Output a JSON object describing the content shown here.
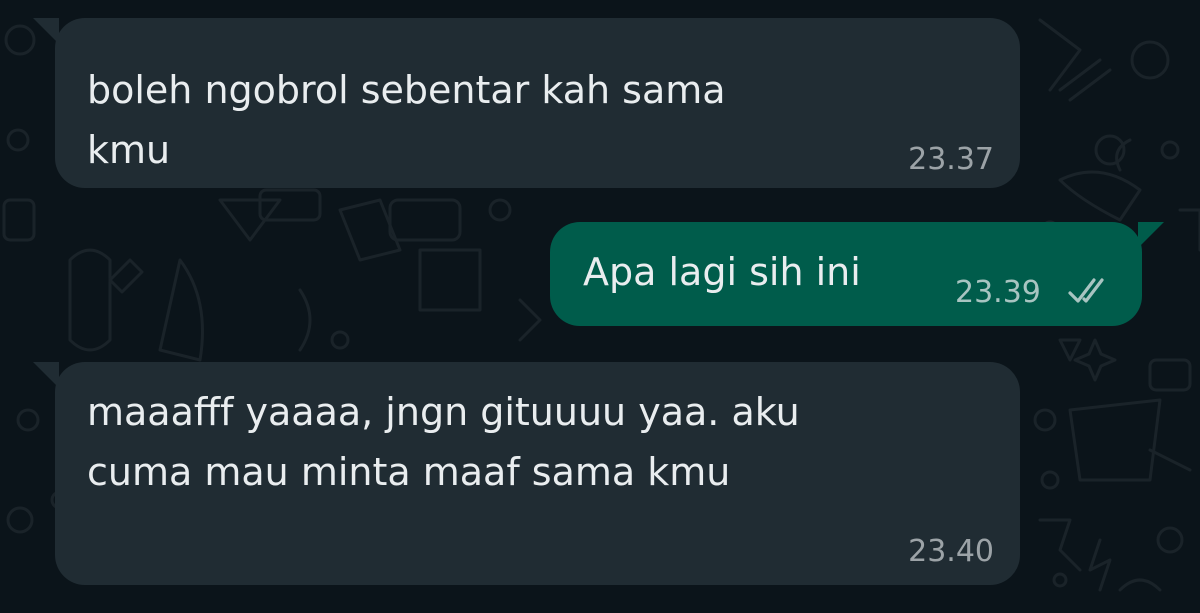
{
  "chat": {
    "messages": [
      {
        "direction": "incoming",
        "text": "boleh ngobrol sebentar kah sama\nkmu",
        "time": "23.37"
      },
      {
        "direction": "outgoing",
        "text": "Apa lagi sih ini",
        "time": "23.39",
        "status_icon": "double-check-icon"
      },
      {
        "direction": "incoming",
        "text": "maaafff yaaaa, jngn gituuuu yaa. aku\ncuma mau minta maaf sama kmu",
        "time": "23.40"
      }
    ]
  },
  "colors": {
    "background": "#0b141a",
    "incoming_bubble": "#202c33",
    "outgoing_bubble": "#005c4b",
    "text": "#e9edef"
  }
}
